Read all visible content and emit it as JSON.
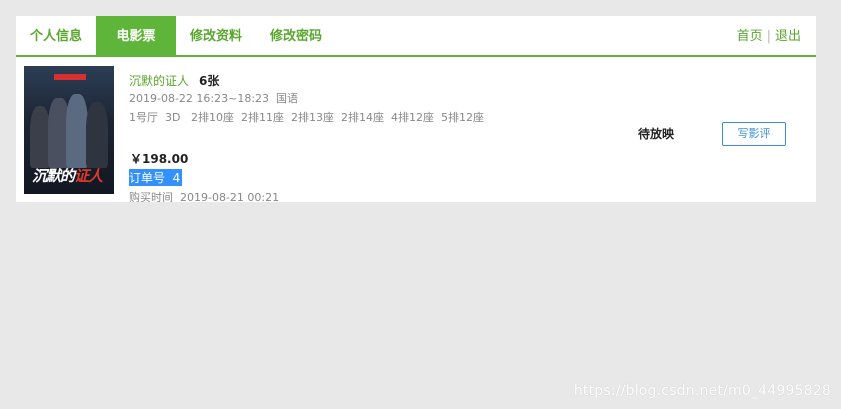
{
  "tabs": [
    {
      "label": "个人信息",
      "active": false
    },
    {
      "label": "电影票",
      "active": true
    },
    {
      "label": "修改资料",
      "active": false
    },
    {
      "label": "修改密码",
      "active": false
    }
  ],
  "top_links": {
    "home": "首页",
    "separator": "|",
    "logout": "退出"
  },
  "order": {
    "movie_name": "沉默的证人",
    "ticket_count": "6张",
    "showtime": "2019-08-22 16:23~18:23",
    "language": "国语",
    "hall": "1号厅",
    "format": "3D",
    "seats": [
      "2排10座",
      "2排11座",
      "2排13座",
      "2排14座",
      "4排12座",
      "5排12座"
    ],
    "price": "￥198.00",
    "order_no_label": "订单号",
    "order_no": "4",
    "buy_time_label": "购买时间",
    "buy_time": "2019-08-21 00:21",
    "status": "待放映",
    "review_button": "写影评"
  },
  "colors": {
    "accent": "#5fb53a",
    "link": "#5aa72f",
    "button": "#3a8fd8",
    "selection": "#3390ff"
  },
  "watermark": "https://blog.csdn.net/m0_44995828"
}
